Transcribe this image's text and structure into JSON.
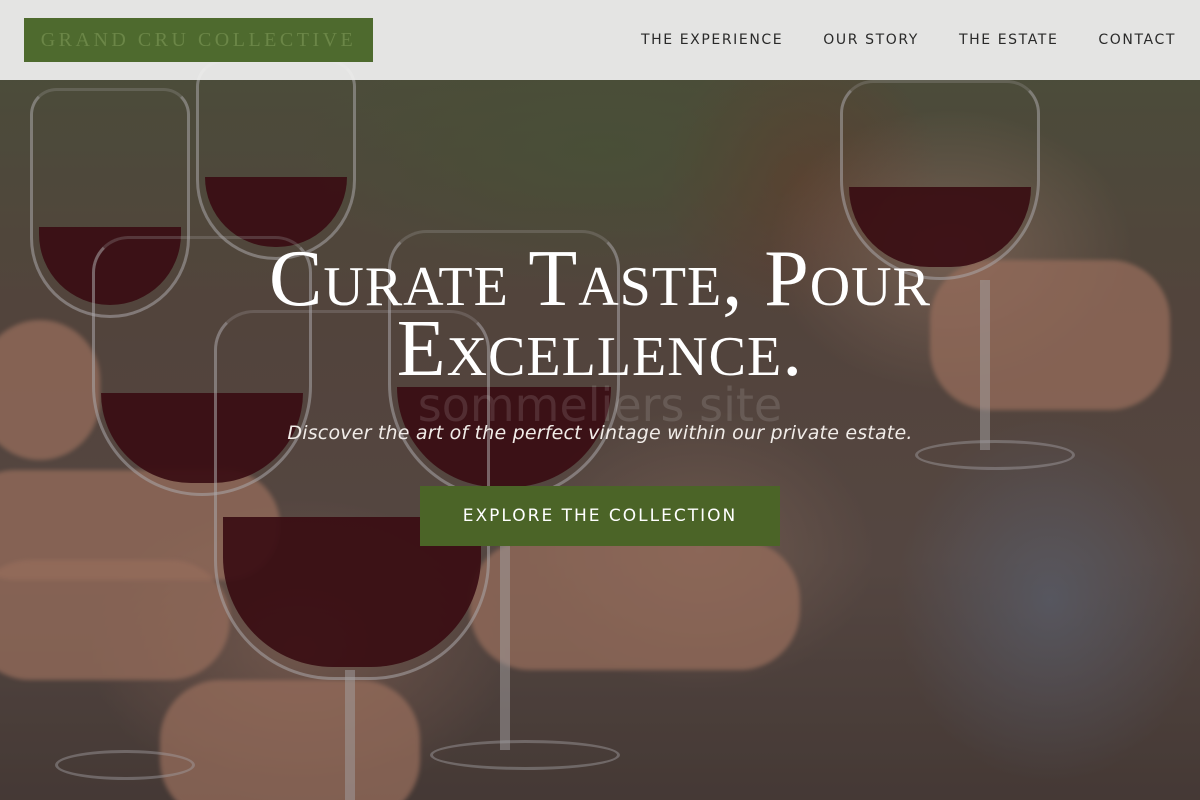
{
  "brand": {
    "logo_text": "Grand Cru Collective"
  },
  "nav": {
    "items": [
      {
        "label": "THE EXPERIENCE"
      },
      {
        "label": "OUR STORY"
      },
      {
        "label": "THE ESTATE"
      },
      {
        "label": "CONTACT"
      }
    ]
  },
  "hero": {
    "headline": "Curate Taste, Pour Excellence.",
    "watermark": "sommeliers site",
    "subtitle": "Discover the art of the perfect vintage within our private estate.",
    "cta_label": "EXPLORE THE COLLECTION"
  },
  "colors": {
    "brand_green": "#4e6a2e",
    "button_green": "#4b6427",
    "nav_background": "#f0f0f0"
  }
}
